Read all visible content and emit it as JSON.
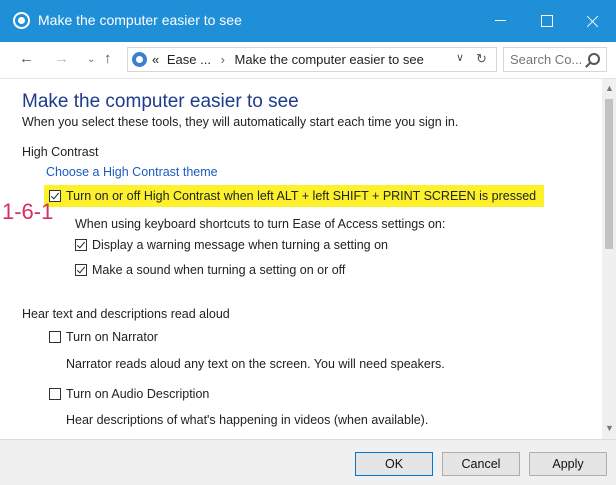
{
  "window": {
    "title": "Make the computer easier to see"
  },
  "address": {
    "prefix": "«",
    "crumb1": "Ease ...",
    "separator": "›",
    "crumb2": "Make the computer easier to see"
  },
  "search": {
    "placeholder": "Search Co..."
  },
  "page": {
    "title": "Make the computer easier to see",
    "subtitle": "When you select these tools, they will automatically start each time you sign in."
  },
  "high_contrast": {
    "section_title": "High Contrast",
    "theme_link": "Choose a High Contrast theme",
    "toggle_shortcut": {
      "label": "Turn on or off High Contrast when left ALT + left SHIFT + PRINT SCREEN is pressed",
      "checked": true
    },
    "shortcut_note": "When using keyboard shortcuts to turn Ease of Access settings on:",
    "warning_message": {
      "label": "Display a warning message when turning a setting on",
      "checked": true
    },
    "sound": {
      "label": "Make a sound when turning a setting on or off",
      "checked": true
    }
  },
  "hear_text": {
    "section_title": "Hear text and descriptions read aloud",
    "narrator": {
      "label": "Turn on Narrator",
      "checked": false
    },
    "narrator_desc": "Narrator reads aloud any text on the screen. You will need speakers.",
    "audio_description": {
      "label": "Turn on Audio Description",
      "checked": false
    },
    "audio_desc_desc": "Hear descriptions of what's happening in videos (when available)."
  },
  "annotation": "1-6-1",
  "buttons": {
    "ok": "OK",
    "cancel": "Cancel",
    "apply": "Apply"
  },
  "colors": {
    "titlebar": "#1f8fd8",
    "highlight": "#fcf12a",
    "title_text": "#1e3b8c",
    "link": "#1a5dbd",
    "annotation": "#d5305f"
  }
}
